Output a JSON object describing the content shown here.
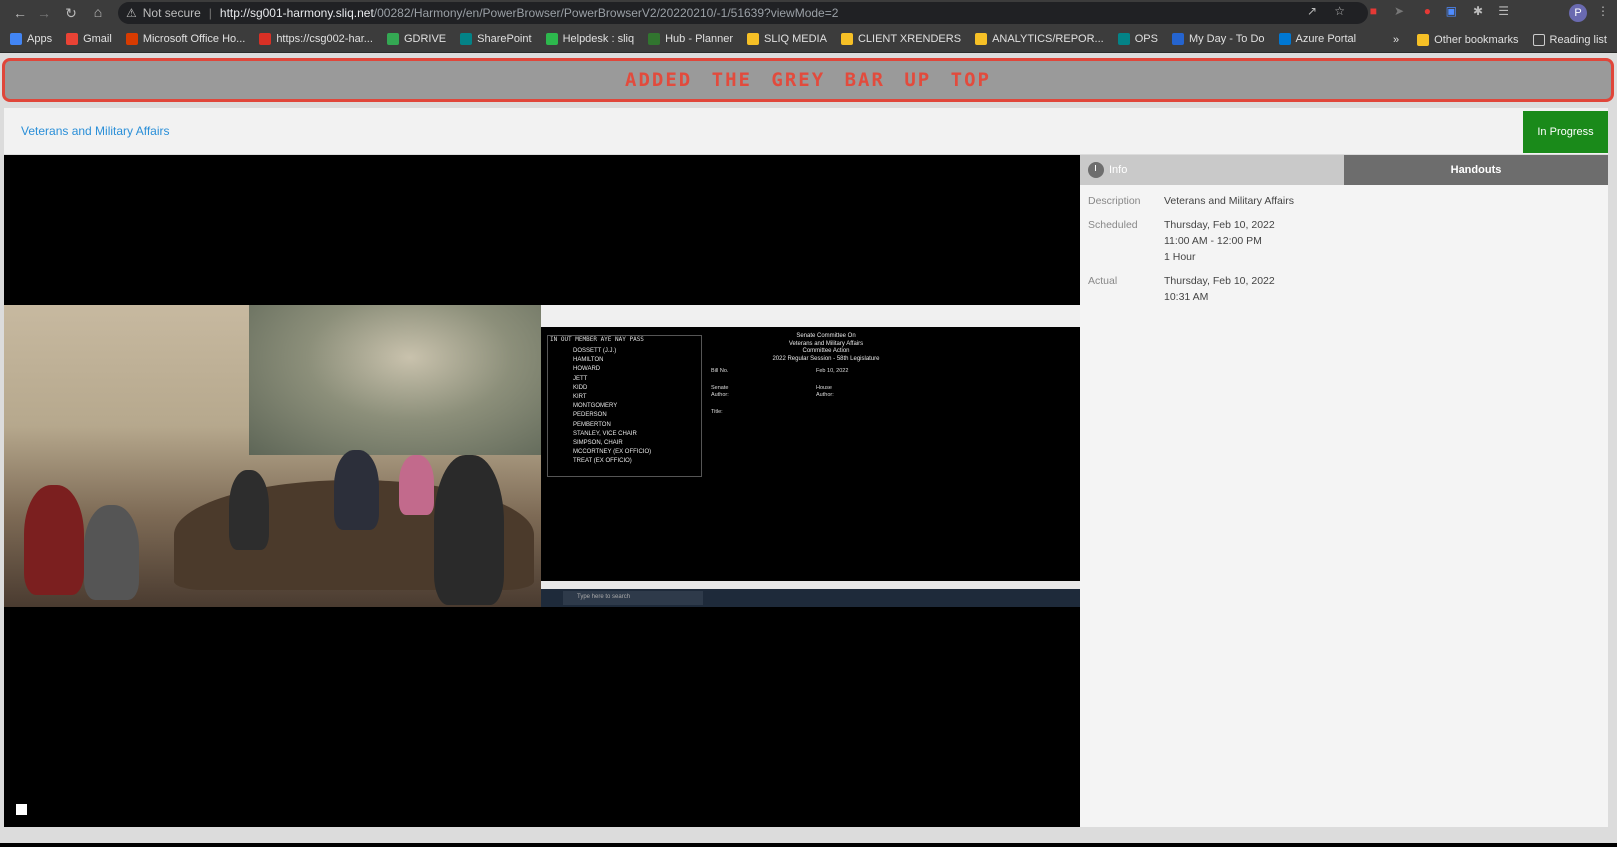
{
  "browser": {
    "security": "Not secure",
    "url_host": "http://sg001-harmony.sliq.net",
    "url_path": "/00282/Harmony/en/PowerBrowser/PowerBrowserV2/20220210/-1/51639?viewMode=2",
    "profile_initial": "P"
  },
  "bookmarks": [
    {
      "label": "Apps",
      "color": "#4285f4"
    },
    {
      "label": "Gmail",
      "color": "#ea4335"
    },
    {
      "label": "Microsoft Office Ho...",
      "color": "#d83b01"
    },
    {
      "label": "https://csg002-har...",
      "color": "#d93025"
    },
    {
      "label": "GDRIVE",
      "color": "#34a853"
    },
    {
      "label": "SharePoint",
      "color": "#038387"
    },
    {
      "label": "Helpdesk : sliq",
      "color": "#2db84d"
    },
    {
      "label": "Hub - Planner",
      "color": "#31752f"
    },
    {
      "label": "SLIQ MEDIA",
      "color": "#f6c026"
    },
    {
      "label": "CLIENT XRENDERS",
      "color": "#f6c026"
    },
    {
      "label": "ANALYTICS/REPOR...",
      "color": "#f6c026"
    },
    {
      "label": "OPS",
      "color": "#038387"
    },
    {
      "label": "My Day - To Do",
      "color": "#2564cf"
    },
    {
      "label": "Azure Portal",
      "color": "#0078d4"
    }
  ],
  "bookmarks_right": {
    "more": "»",
    "other": "Other bookmarks",
    "reading": "Reading list"
  },
  "banner": {
    "text": "ADDED THE GREY BAR UP TOP"
  },
  "header": {
    "title": "Veterans and Military Affairs",
    "status": "In Progress"
  },
  "video": {
    "roll_header": "IN OUT MEMBER                AYE NAY PASS",
    "members": [
      "DOSSETT (J.J.)",
      "HAMILTON",
      "HOWARD",
      "JETT",
      "KIDD",
      "KIRT",
      "MONTGOMERY",
      "PEDERSON",
      "PEMBERTON",
      "STANLEY, VICE CHAIR",
      "SIMPSON, CHAIR",
      "MCCORTNEY (EX OFFICIO)",
      "TREAT (EX OFFICIO)"
    ],
    "committee_lines": [
      "Senate Committee On",
      "Veterans and Military Affairs",
      "Committee Action",
      "2022 Regular Session - 58th Legislature"
    ],
    "bill_no": "Bill No.",
    "date": "Feb 10, 2022",
    "senate_author": "Senate Author:",
    "house_author": "House Author:",
    "title_label": "Title:",
    "taskbar_search": "Type here to search"
  },
  "tabs": {
    "info": "Info",
    "handouts": "Handouts"
  },
  "info": {
    "description_label": "Description",
    "description": "Veterans and Military Affairs",
    "scheduled_label": "Scheduled",
    "scheduled_date": "Thursday, Feb 10, 2022",
    "scheduled_time": "11:00 AM - 12:00 PM",
    "scheduled_duration": "1 Hour",
    "actual_label": "Actual",
    "actual_date": "Thursday, Feb 10, 2022",
    "actual_time": "10:31 AM"
  }
}
